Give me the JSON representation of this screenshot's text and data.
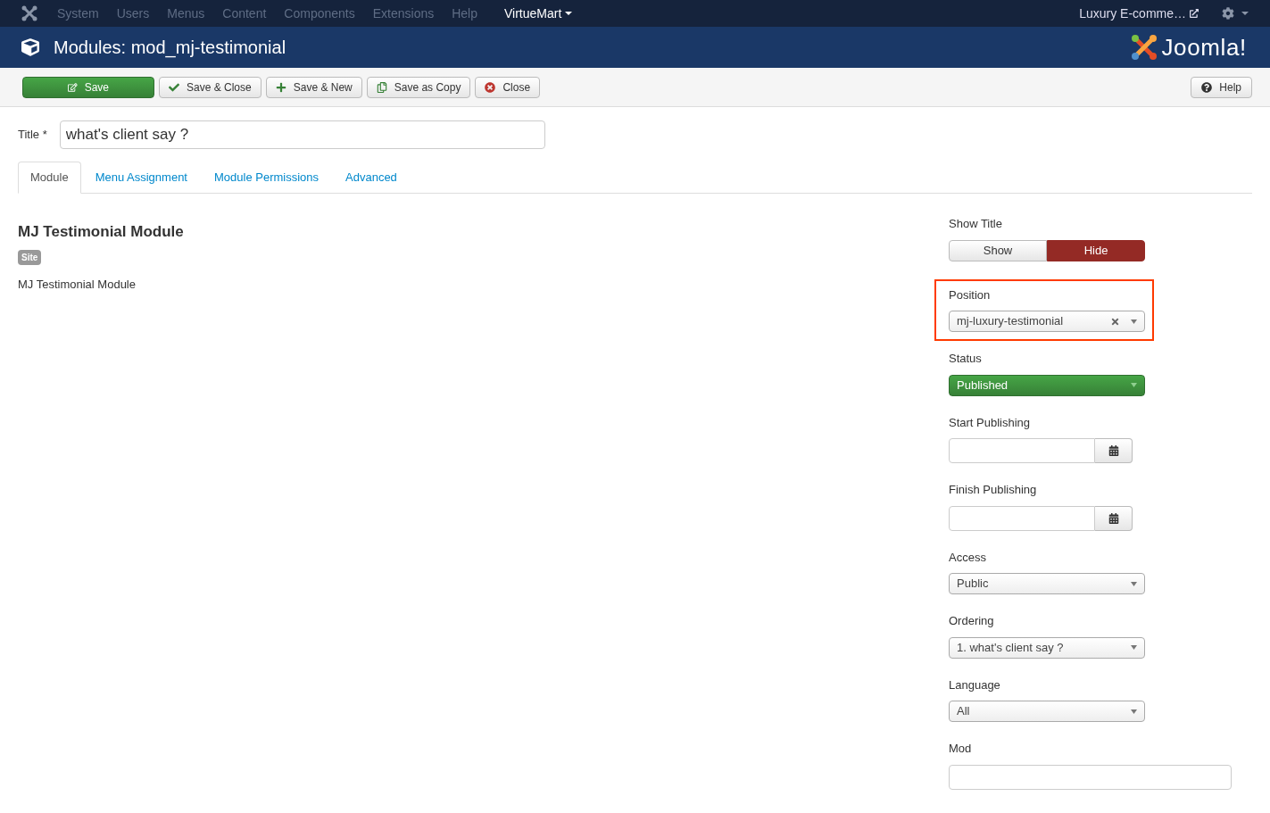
{
  "topbar": {
    "menu": [
      "System",
      "Users",
      "Menus",
      "Content",
      "Components",
      "Extensions",
      "Help"
    ],
    "dropdown": "VirtueMart",
    "site_link": "Luxury E-comme…"
  },
  "header": {
    "title": "Modules: mod_mj-testimonial",
    "logo": "Joomla!"
  },
  "toolbar": {
    "buttons": [
      {
        "kind": "save",
        "label": "Save"
      },
      {
        "kind": "save-close",
        "label": "Save & Close"
      },
      {
        "kind": "save-new",
        "label": "Save & New"
      },
      {
        "kind": "copy",
        "label": "Save as Copy"
      },
      {
        "kind": "close",
        "label": "Close"
      }
    ],
    "help": "Help"
  },
  "title_field": {
    "label": "Title *",
    "value": "what's client say ?"
  },
  "tabs": [
    {
      "label": "Module",
      "selected": true
    },
    {
      "label": "Menu Assignment",
      "selected": false
    },
    {
      "label": "Module Permissions",
      "selected": false
    },
    {
      "label": "Advanced",
      "selected": false
    }
  ],
  "module": {
    "heading": "MJ Testimonial Module",
    "badge": "Site",
    "description": "MJ Testimonial Module"
  },
  "fields": [
    {
      "kind": "toggle",
      "label": "Show Title",
      "options": [
        {
          "label": "Show",
          "selected": false
        },
        {
          "label": "Hide",
          "selected": true
        }
      ]
    },
    {
      "kind": "select",
      "label": "Position",
      "value": "mj-luxury-testimonial",
      "clearable": true,
      "highlighted": true
    },
    {
      "kind": "status-select",
      "label": "Status",
      "value": "Published"
    },
    {
      "kind": "date",
      "label": "Start Publishing"
    },
    {
      "kind": "date",
      "label": "Finish Publishing"
    },
    {
      "kind": "select",
      "label": "Access",
      "value": "Public"
    },
    {
      "kind": "select",
      "label": "Ordering",
      "value": "1. what's client say ?"
    },
    {
      "kind": "select",
      "label": "Language",
      "value": "All"
    },
    {
      "kind": "text",
      "label": "Mod"
    }
  ]
}
